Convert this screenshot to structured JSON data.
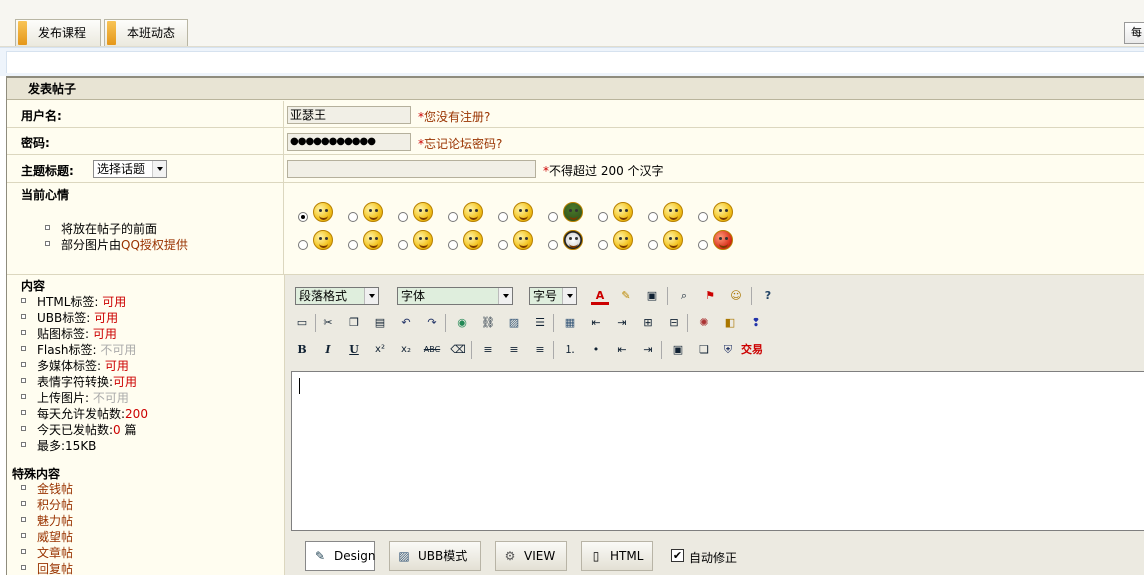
{
  "tabs": [
    {
      "label": "发布课程"
    },
    {
      "label": "本班动态"
    }
  ],
  "right_button": {
    "label": "每"
  },
  "form": {
    "title": "发表帖子",
    "username": {
      "label": "用户名:",
      "value": "亚瑟王",
      "hint_star": "*",
      "hint_text": "您没有注册?"
    },
    "password": {
      "label": "密码:",
      "value": "●●●●●●●●●●●",
      "hint_star": "*",
      "hint_text": "忘记论坛密码?"
    },
    "subject": {
      "label": "主题标题:",
      "topic_select": "选择话题",
      "value": "",
      "hint_star": "*",
      "hint_text": "不得超过 200 个汉字"
    },
    "mood": {
      "label": "当前心情",
      "notes": [
        "将放在帖子的前面",
        "部分图片由"
      ],
      "qq_link": "QQ授权提供",
      "selected_index": 0,
      "emoticons": [
        "smile",
        "smug",
        "happy",
        "love",
        "tongue",
        "army",
        "surprised",
        "wink",
        "grin",
        "cry",
        "angry",
        "sob",
        "laugh",
        "sleepy",
        "frightened",
        "sad",
        "hammered",
        "devil"
      ]
    },
    "content": {
      "label": "内容",
      "rules": [
        {
          "name": "HTML标签:",
          "value": "可用",
          "status": "on"
        },
        {
          "name": "UBB标签:",
          "value": "可用",
          "status": "on"
        },
        {
          "name": "贴图标签:",
          "value": "可用",
          "status": "on"
        },
        {
          "name": "Flash标签:",
          "value": "不可用",
          "status": "off"
        },
        {
          "name": "多媒体标签:",
          "value": "可用",
          "status": "on"
        },
        {
          "name": "表情字符转换:",
          "value": "可用",
          "status": "on"
        },
        {
          "name": "上传图片:",
          "value": "不可用",
          "status": "off"
        },
        {
          "name": "每天允许发帖数:",
          "value": "200",
          "status": "on"
        },
        {
          "name": "今天已发帖数:",
          "value": "0",
          "suffix": "篇",
          "status": "on"
        },
        {
          "name": "最多:",
          "value": "15KB",
          "status": "plain"
        }
      ],
      "special_label": "特殊内容",
      "special_items": [
        "金钱帖",
        "积分帖",
        "魅力帖",
        "威望帖",
        "文章帖",
        "回复帖"
      ]
    },
    "editor": {
      "para_format": "段落格式",
      "font": "字体",
      "font_size": "字号",
      "trade_label": "交易",
      "modes": [
        "Design",
        "UBB模式",
        "VIEW",
        "HTML"
      ],
      "active_mode": "Design",
      "autofix_label": "自动修正",
      "autofix_checked": true
    }
  },
  "colors": {
    "accent_red": "#cc0000",
    "link_brown": "#993300",
    "frame_bg": "#fffdf0"
  }
}
